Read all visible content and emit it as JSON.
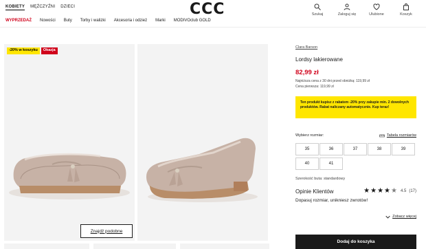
{
  "header": {
    "gender_tabs": [
      "KOBIETY",
      "MĘŻCZYŹNI",
      "DZIECI"
    ],
    "logo": "CCC",
    "actions": [
      {
        "label": "Szukaj",
        "icon": "search-icon"
      },
      {
        "label": "Zaloguj się",
        "icon": "user-icon"
      },
      {
        "label": "Ulubione",
        "icon": "heart-icon"
      },
      {
        "label": "Koszyk",
        "icon": "bag-icon"
      }
    ],
    "categories": [
      "WYPRZEDAŻ",
      "Nowości",
      "Buty",
      "Torby i walizki",
      "Akcesoria i odzież",
      "Marki",
      "MODIVOclub GOLD"
    ]
  },
  "gallery": {
    "badge_promo": "-20% w koszyku",
    "badge_deal": "Okazja",
    "similar_button": "Znajdź podobne"
  },
  "product": {
    "brand": "Clara Barson",
    "name": "Lordsy lakierowane",
    "price": "82,99 zł",
    "lowest_price": "Najniższa cena z 30 dni przed obniżką: 119,99 zł",
    "first_price": "Cena pierwsza: 119,99 zł",
    "promo_text": "Ten produkt kupisz z rabatem -20% przy zakupie min. 2 dowolnych produktów. Rabat naliczany automatycznie. Kup teraz!",
    "size_label": "Wybierz rozmiar:",
    "size_guide": "Tabela rozmiarów",
    "sizes": [
      "35",
      "36",
      "37",
      "38",
      "39",
      "40",
      "41"
    ],
    "fit": "Szerokość buta: standardowy",
    "reviews_title": "Opinie Klientów",
    "rating": 4.5,
    "rating_text": "4.5",
    "review_count": "(17)",
    "review_message": "Dopasuj rozmiar, unikniesz zwrotów!",
    "see_all": "Zobacz więcej",
    "add_to_cart": "Dodaj do koszyka"
  },
  "colors": {
    "accent_red": "#d0021b",
    "promo_yellow": "#ffe600",
    "shoe_body": "#c7b2a6"
  }
}
